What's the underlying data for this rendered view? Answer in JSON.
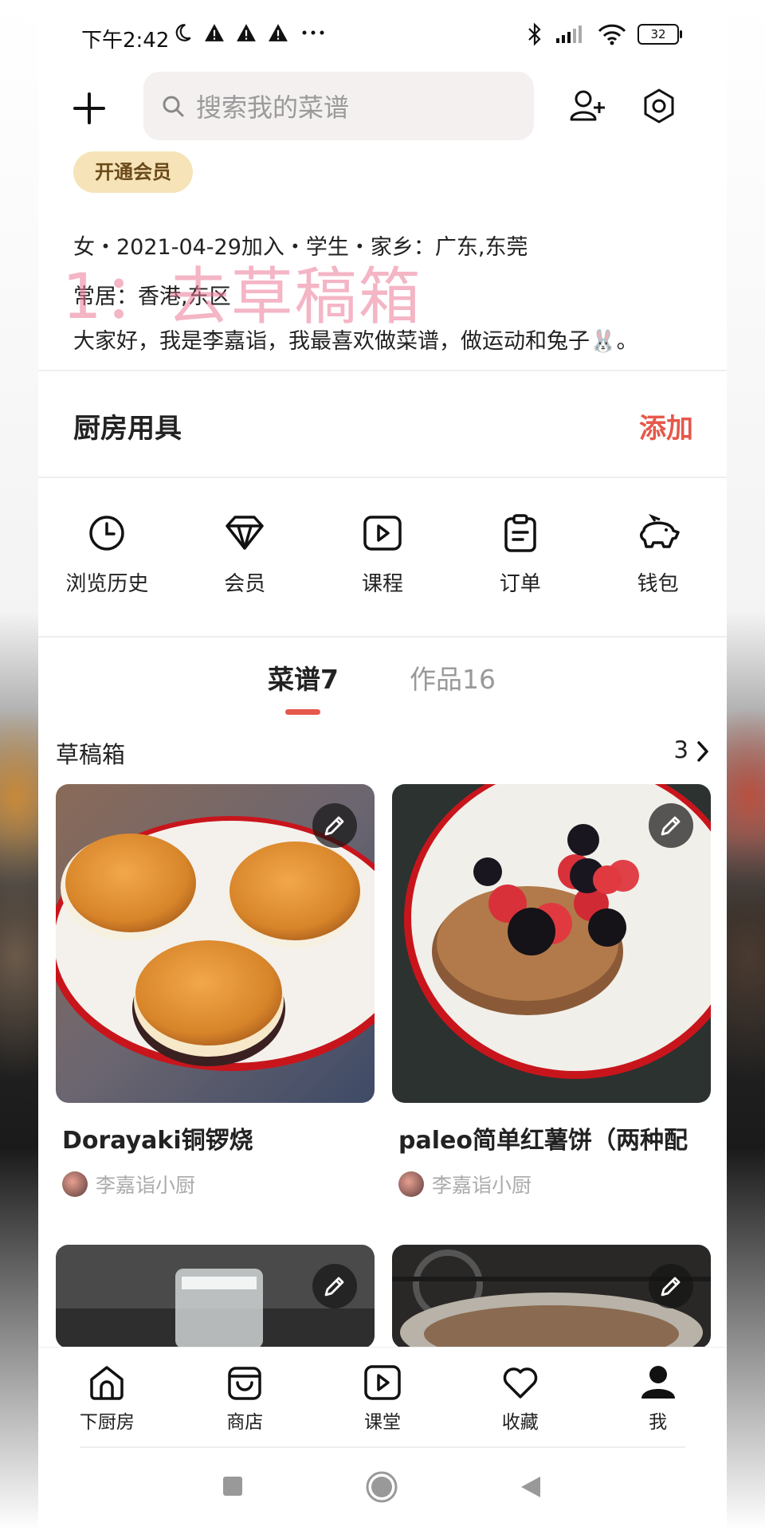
{
  "status_bar": {
    "time": "下午2:42",
    "battery": "32"
  },
  "search": {
    "placeholder": "搜索我的菜谱"
  },
  "profile": {
    "vip_label": "开通会员",
    "info_line": "女・2021-04-29加入・学生・家乡：广东,东莞",
    "residence": "常居：香港,东区",
    "bio": "大家好，我是李嘉诣，我最喜欢做菜谱，做运动和兔子🐰。",
    "overlay_text": "1：去草稿箱"
  },
  "kitchen_tools": {
    "title": "厨房用具",
    "action": "添加"
  },
  "quick_actions": [
    {
      "label": "浏览历史",
      "icon": "clock-icon"
    },
    {
      "label": "会员",
      "icon": "diamond-icon"
    },
    {
      "label": "课程",
      "icon": "play-icon"
    },
    {
      "label": "订单",
      "icon": "clipboard-icon"
    },
    {
      "label": "钱包",
      "icon": "piggy-bank-icon"
    }
  ],
  "tabs": [
    {
      "label": "菜谱7"
    },
    {
      "label": "作品16"
    }
  ],
  "drafts": {
    "title": "草稿箱",
    "count": "3"
  },
  "cards": [
    {
      "name": "Dorayaki铜锣烧",
      "author": "李嘉诣小厨"
    },
    {
      "name": "paleo简单红薯饼（两种配",
      "author": "李嘉诣小厨"
    },
    {
      "name": "",
      "author": ""
    },
    {
      "name": "",
      "author": ""
    }
  ],
  "bottom_nav": [
    {
      "label": "下厨房",
      "icon": "home-icon"
    },
    {
      "label": "商店",
      "icon": "shop-icon"
    },
    {
      "label": "课堂",
      "icon": "play-icon"
    },
    {
      "label": "收藏",
      "icon": "heart-icon"
    },
    {
      "label": "我",
      "icon": "person-icon"
    }
  ],
  "colors": {
    "accent": "#e5584a",
    "vip_bg": "#f6e3b8"
  }
}
